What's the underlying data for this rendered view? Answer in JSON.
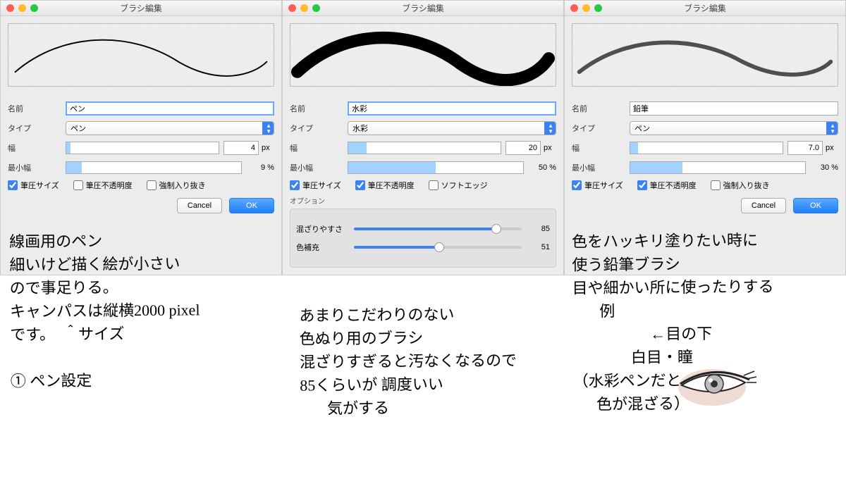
{
  "panels": [
    {
      "window_title": "ブラシ編集",
      "stroke_style": "thin",
      "name_label": "名前",
      "name_value": "ペン",
      "type_label": "タイプ",
      "type_value": "ペン",
      "width_label": "幅",
      "width_value": "4",
      "width_unit": "px",
      "width_fill_pct": 3,
      "minwidth_label": "最小幅",
      "minwidth_pct": "9 %",
      "minwidth_fill_pct": 9,
      "checks": [
        {
          "label": "筆圧サイズ",
          "checked": true
        },
        {
          "label": "筆圧不透明度",
          "checked": false
        },
        {
          "label": "強制入り抜き",
          "checked": false
        }
      ],
      "has_options": false,
      "cancel": "Cancel",
      "ok": "OK"
    },
    {
      "window_title": "ブラシ編集",
      "stroke_style": "thick",
      "name_label": "名前",
      "name_value": "水彩",
      "type_label": "タイプ",
      "type_value": "水彩",
      "width_label": "幅",
      "width_value": "20",
      "width_unit": "px",
      "width_fill_pct": 12,
      "minwidth_label": "最小幅",
      "minwidth_pct": "50 %",
      "minwidth_fill_pct": 50,
      "checks": [
        {
          "label": "筆圧サイズ",
          "checked": true
        },
        {
          "label": "筆圧不透明度",
          "checked": true
        },
        {
          "label": "ソフトエッジ",
          "checked": false
        }
      ],
      "has_options": true,
      "options_label": "オプション",
      "options": [
        {
          "label": "混ざりやすさ",
          "value": "85",
          "pct": 85
        },
        {
          "label": "色補充",
          "value": "51",
          "pct": 51
        }
      ]
    },
    {
      "window_title": "ブラシ編集",
      "stroke_style": "soft",
      "name_label": "名前",
      "name_value": "鉛筆",
      "type_label": "タイプ",
      "type_value": "ペン",
      "width_label": "幅",
      "width_value": "7.0",
      "width_unit": "px",
      "width_fill_pct": 5,
      "minwidth_label": "最小幅",
      "minwidth_pct": "30 %",
      "minwidth_fill_pct": 30,
      "checks": [
        {
          "label": "筆圧サイズ",
          "checked": true
        },
        {
          "label": "筆圧不透明度",
          "checked": true
        },
        {
          "label": "強制入り抜き",
          "checked": false
        }
      ],
      "has_options": false,
      "cancel": "Cancel",
      "ok": "OK"
    }
  ],
  "notes": {
    "left": "線画用のペン\n細いけど描く絵が小さい\nので事足りる。\nキャンパスは縦横2000 pixel\nです。  ＾サイズ\n\n① ペン設定",
    "center": "あまりこだわりのない\n色ぬり用のブラシ\n混ざりすぎると汚なくなるので\n85くらいが 調度いい\n       気がする",
    "right": "色をハッキリ塗りたい時に\n使う鉛筆ブラシ\n目や細かい所に使ったりする\n       例\n                    ←目の下\n               白目・瞳\n（水彩ペンだと\n      色が混ざる）"
  }
}
